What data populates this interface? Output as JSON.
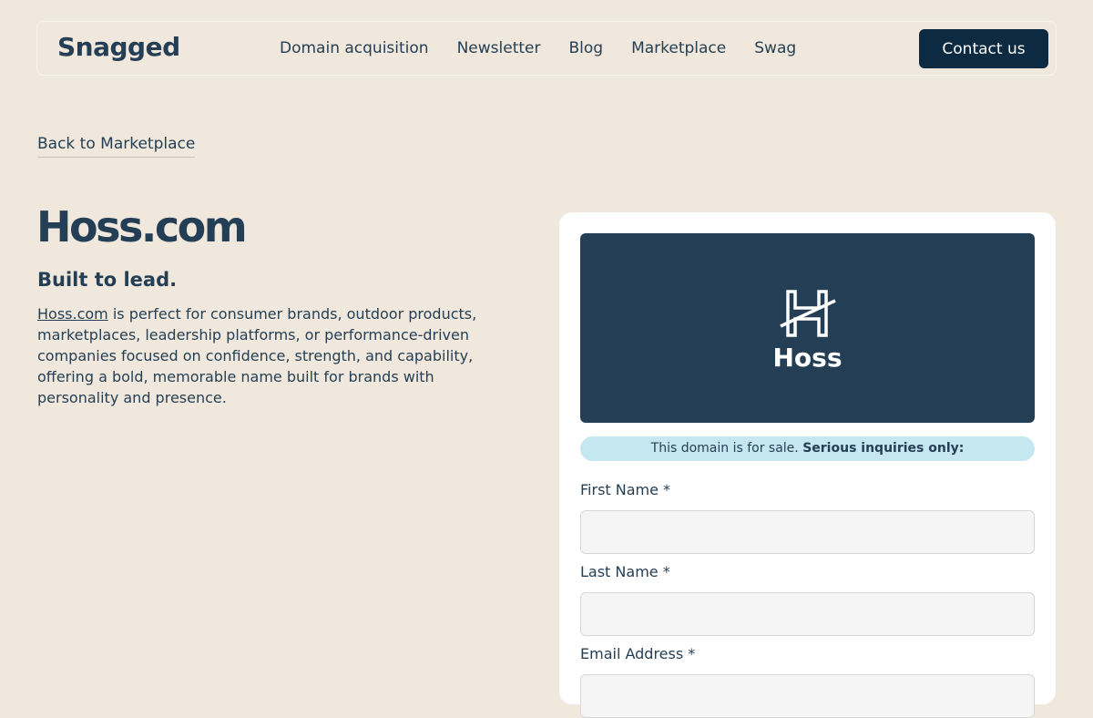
{
  "header": {
    "logo": "Snagged",
    "nav": [
      "Domain acquisition",
      "Newsletter",
      "Blog",
      "Marketplace",
      "Swag"
    ],
    "contact_label": "Contact us"
  },
  "back_link": "Back to Marketplace",
  "listing": {
    "domain": "Hoss.com",
    "tagline": "Built to lead.",
    "description_link": "Hoss.com",
    "description_rest": " is perfect for consumer brands, outdoor products, marketplaces, leadership platforms, or performance-driven companies focused on confidence, strength, and capability, offering a bold, memorable name built for brands with personality and presence."
  },
  "card": {
    "banner_name": "Hoss",
    "sale_text": "This domain is for sale.",
    "sale_bold": "Serious inquiries only:",
    "fields": [
      {
        "label": "First Name *",
        "value": ""
      },
      {
        "label": "Last Name *",
        "value": ""
      },
      {
        "label": "Email Address *",
        "value": ""
      }
    ]
  },
  "colors": {
    "background": "#f0e8dc",
    "text": "#243f55",
    "button": "#0c2b42",
    "banner": "#243f55",
    "pill": "#c5e7f0"
  },
  "icons": {
    "banner_mark": "h-monogram-logo"
  }
}
